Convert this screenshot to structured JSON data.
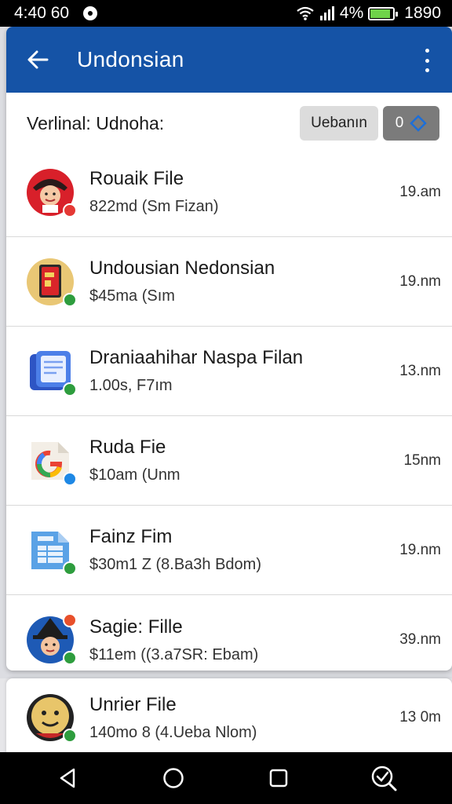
{
  "status_bar": {
    "time": "4:40 60",
    "battery_text": "4%",
    "clock_right": "1890",
    "battery_level": 0.9,
    "battery_color": "#6fd34a"
  },
  "app_bar": {
    "title": "Undonsian",
    "color": "#1553a6",
    "back_icon": "arrow-left-icon",
    "menu_icon": "more-vertical-icon"
  },
  "header": {
    "label": "Verlinal: Udnoha:",
    "button_label": "Uebanın",
    "select_value": "0"
  },
  "files": [
    {
      "title": "Rouaik File",
      "subtitle": "822md (Sm Fizan)",
      "time": "19.am",
      "icon": "pirate-avatar-icon",
      "badge_color": "#e53935"
    },
    {
      "title": "Undousian Nedonsian",
      "subtitle": "$45ma (Sım",
      "time": "19.nm",
      "icon": "red-book-icon",
      "badge_color": "#2e9d3e"
    },
    {
      "title": "Draniaahihar Naspa Filan",
      "subtitle": "1.00s, F7ım",
      "time": "13.nm",
      "icon": "blue-document-icon",
      "badge_color": "#2e9d3e"
    },
    {
      "title": "Ruda Fie",
      "subtitle": "$10am (Unm",
      "time": "15nm",
      "icon": "google-file-icon",
      "badge_color": "#1e88e5"
    },
    {
      "title": "Fainz Fim",
      "subtitle": "$30m1 Z (8.Ba3h Bdom)",
      "time": "19.nm",
      "icon": "spreadsheet-file-icon",
      "badge_color": "#2e9d3e"
    },
    {
      "title": "Sagie: Fille",
      "subtitle": "$11em ((3.a7SR: Ebam)",
      "time": "39.nm",
      "icon": "witch-avatar-icon",
      "badge_color": "#2e9d3e"
    }
  ],
  "partial_file": {
    "title": "Unrier File",
    "subtitle": "140mo 8 (4.Ueba Nlom)",
    "time": "13 0m",
    "icon": "smiley-avatar-icon",
    "badge_color": "#2e9d3e"
  },
  "nav": {
    "back_icon": "triangle-back-icon",
    "home_icon": "circle-home-icon",
    "recents_icon": "square-recents-icon",
    "search_icon": "search-check-icon"
  }
}
